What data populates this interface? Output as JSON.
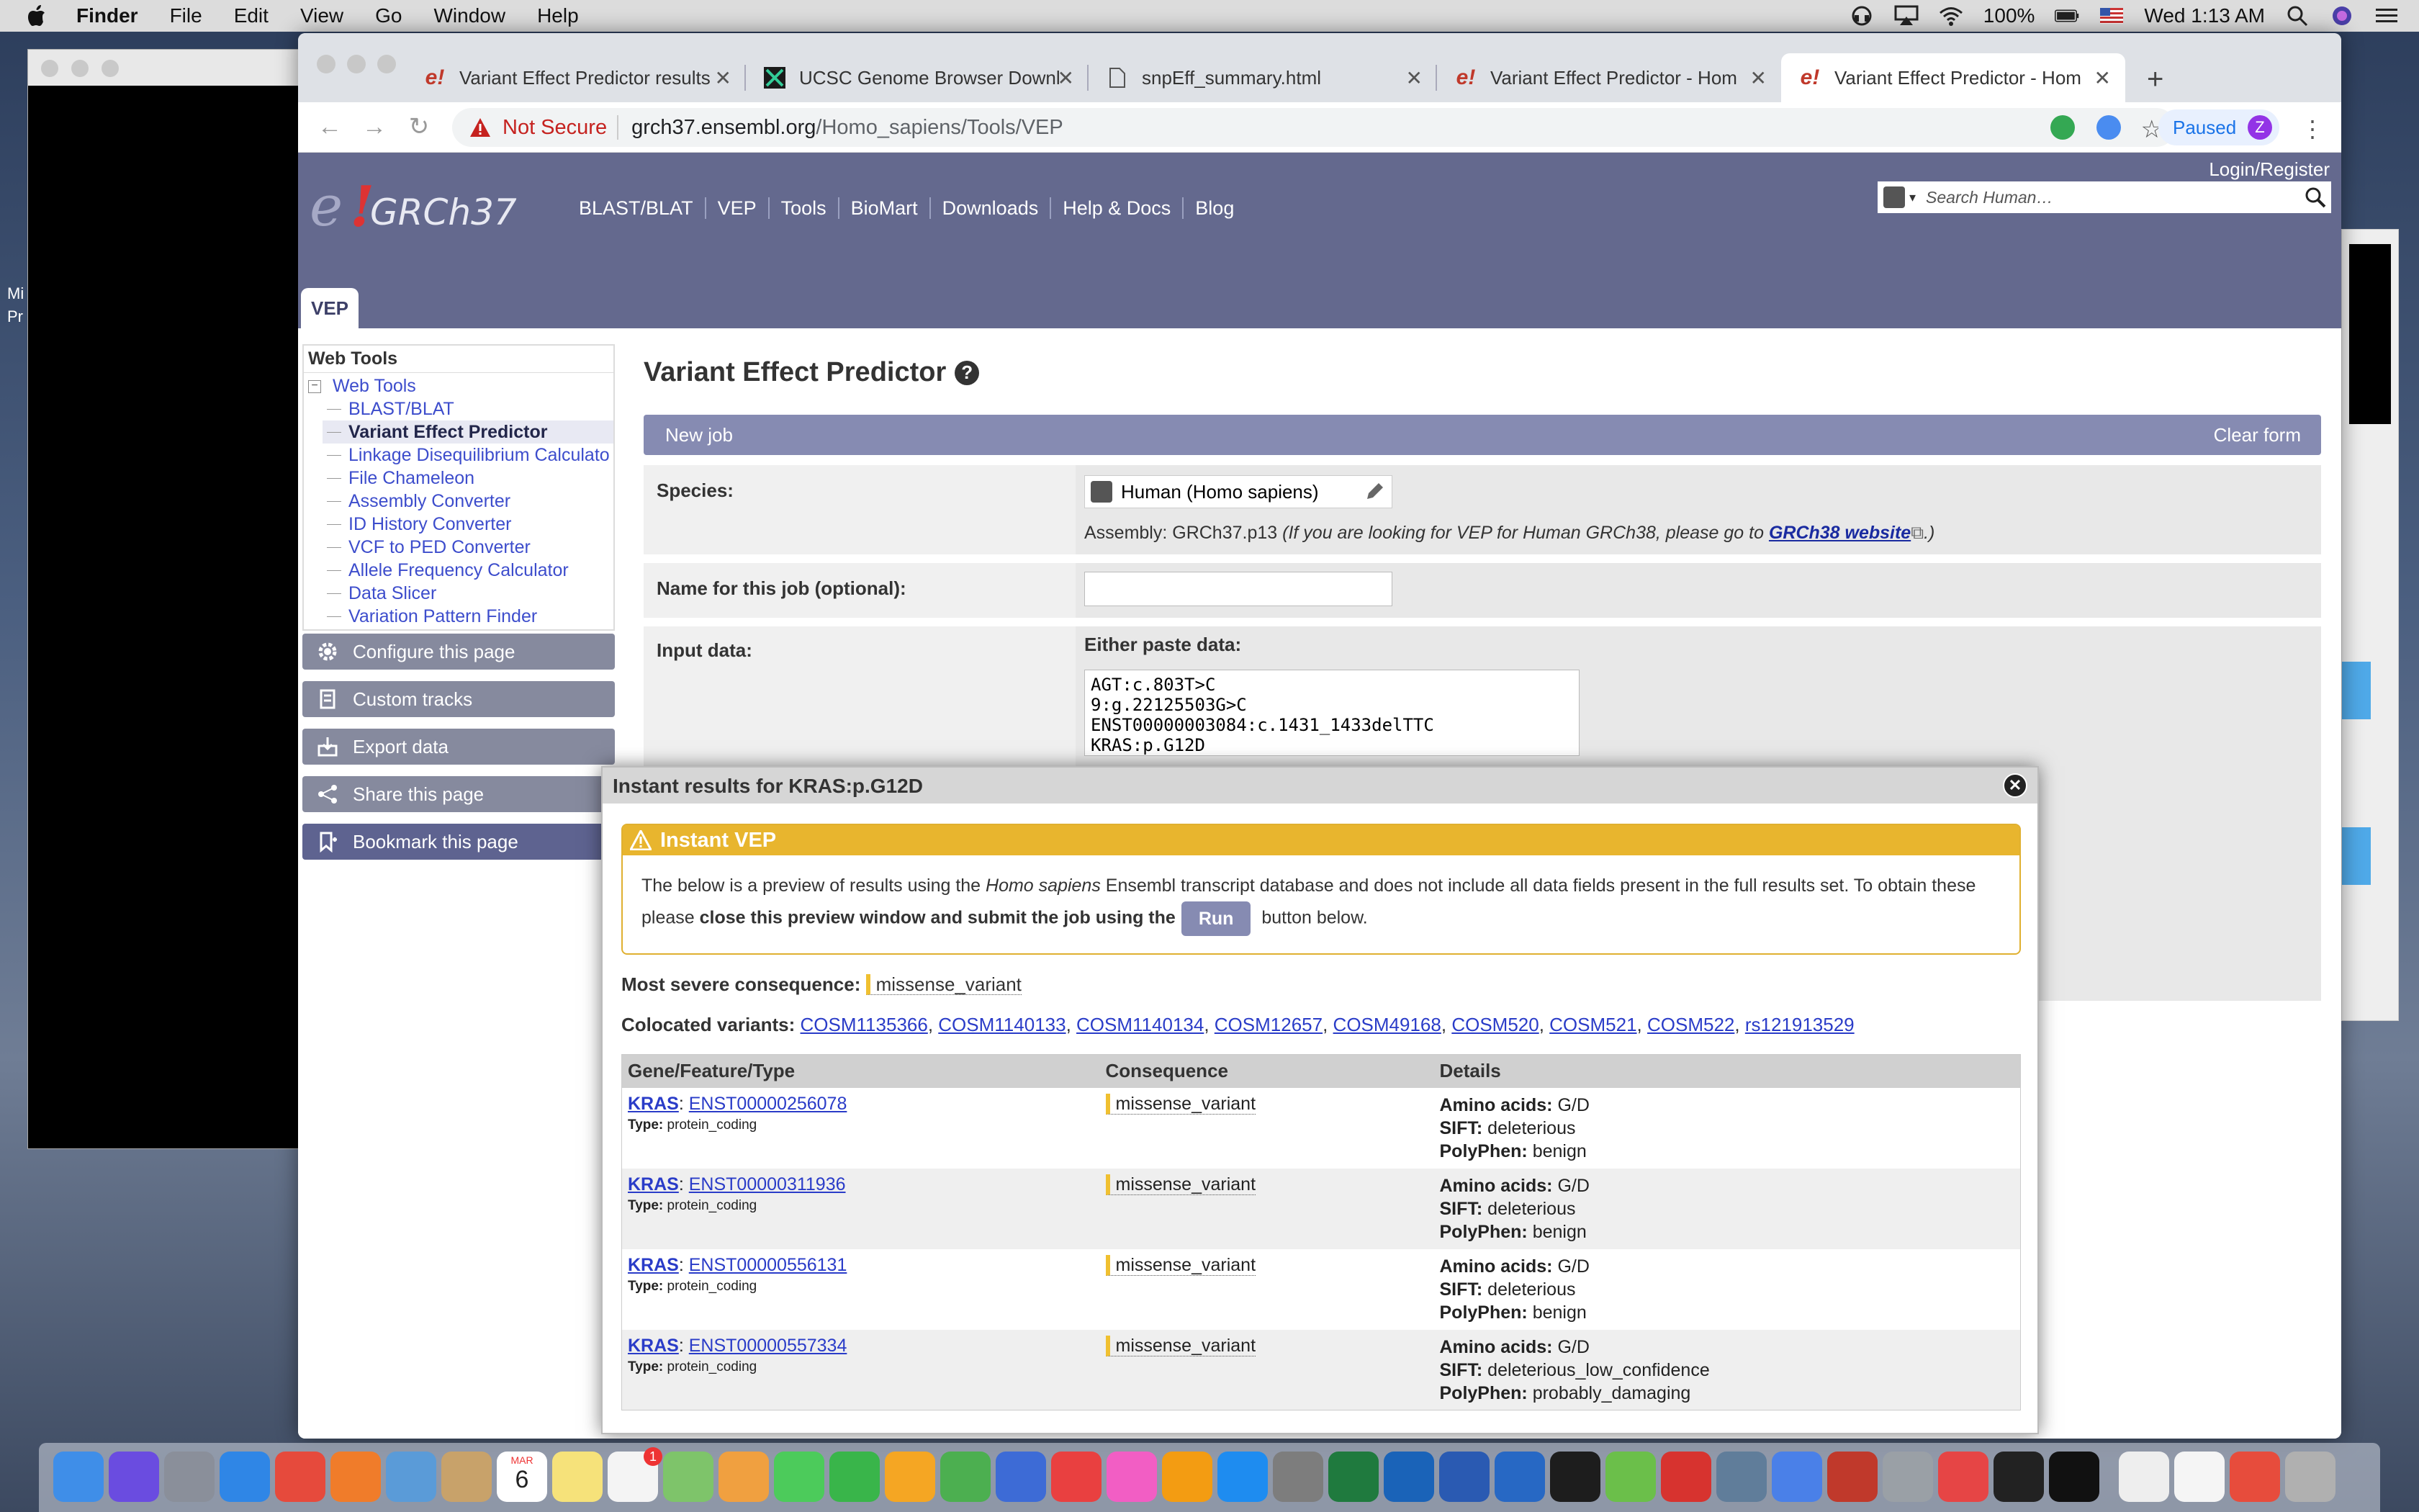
{
  "menubar": {
    "items": [
      "Finder",
      "File",
      "Edit",
      "View",
      "Go",
      "Window",
      "Help"
    ],
    "battery": "100%",
    "clock": "Wed 1:13 AM"
  },
  "desktop": {
    "clipped_text_1": "Mi",
    "clipped_text_2": "Pr"
  },
  "tabs": [
    {
      "title": "Variant Effect Predictor results",
      "favicon": "ensembl-icon"
    },
    {
      "title": "UCSC Genome Browser Downl",
      "favicon": "ucsc-icon"
    },
    {
      "title": "snpEff_summary.html",
      "favicon": "file-icon"
    },
    {
      "title": "Variant Effect Predictor - Hom",
      "favicon": "ensembl-icon"
    },
    {
      "title": "Variant Effect Predictor - Hom",
      "favicon": "ensembl-icon"
    }
  ],
  "omnibox": {
    "security": "Not Secure",
    "host": "grch37.ensembl.org",
    "path": "/Homo_sapiens/Tools/VEP"
  },
  "profile": {
    "label": "Paused",
    "initial": "Z"
  },
  "ensembl": {
    "assembly": "GRCh37",
    "nav": [
      "BLAST/BLAT",
      "VEP",
      "Tools",
      "BioMart",
      "Downloads",
      "Help & Docs",
      "Blog"
    ],
    "login": "Login/Register",
    "search_placeholder": "Search Human…",
    "section_tab": "VEP"
  },
  "sidebar": {
    "header": "Web Tools",
    "root": "Web Tools",
    "items": [
      "BLAST/BLAT",
      "Variant Effect Predictor",
      "Linkage Disequilibrium Calculato",
      "File Chameleon",
      "Assembly Converter",
      "ID History Converter",
      "VCF to PED Converter",
      "Allele Frequency Calculator",
      "Data Slicer",
      "Variation Pattern Finder"
    ],
    "buttons": [
      "Configure this page",
      "Custom tracks",
      "Export data",
      "Share this page",
      "Bookmark this page"
    ]
  },
  "form": {
    "title": "Variant Effect Predictor",
    "new_job": "New job",
    "clear_form": "Clear form",
    "species_label": "Species:",
    "species_value": "Human (Homo sapiens)",
    "assembly_prefix": "Assembly: GRCh37.p13 ",
    "assembly_note": "(If you are looking for VEP for Human GRCh38, please go to ",
    "assembly_link": "GRCh38 website",
    "assembly_suffix": ".)",
    "job_name_label": "Name for this job (optional):",
    "job_name_value": "",
    "input_label": "Input data:",
    "paste_label": "Either paste data:",
    "paste_value": "AGT:c.803T>C\n9:g.22125503G>C\nENST00000003084:c.1431_1433delTTC\nKRAS:p.G12D"
  },
  "popup": {
    "title": "Instant results for KRAS:p.G12D",
    "warning_title": "Instant VEP",
    "warning_text_1": "The below is a preview of results using the ",
    "warning_species": "Homo sapiens",
    "warning_text_2": " Ensembl transcript database and does not include all data fields present in the full results set. To obtain these please ",
    "warning_bold": "close this preview window and submit the job using the",
    "run_label": "Run",
    "warning_text_3": " button below.",
    "most_severe_label": "Most severe consequence:",
    "most_severe_value": "missense_variant",
    "colocated_label": "Colocated variants:",
    "colocated": [
      "COSM1135366",
      "COSM1140133",
      "COSM1140134",
      "COSM12657",
      "COSM49168",
      "COSM520",
      "COSM521",
      "COSM522",
      "rs121913529"
    ],
    "columns": [
      "Gene/Feature/Type",
      "Consequence",
      "Details"
    ],
    "rows": [
      {
        "gene": "KRAS",
        "feature": "ENST00000256078",
        "type": "protein_coding",
        "consequence": "missense_variant",
        "amino": "G/D",
        "sift": "deleterious",
        "polyphen": "benign"
      },
      {
        "gene": "KRAS",
        "feature": "ENST00000311936",
        "type": "protein_coding",
        "consequence": "missense_variant",
        "amino": "G/D",
        "sift": "deleterious",
        "polyphen": "benign"
      },
      {
        "gene": "KRAS",
        "feature": "ENST00000556131",
        "type": "protein_coding",
        "consequence": "missense_variant",
        "amino": "G/D",
        "sift": "deleterious",
        "polyphen": "benign"
      },
      {
        "gene": "KRAS",
        "feature": "ENST00000557334",
        "type": "protein_coding",
        "consequence": "missense_variant",
        "amino": "G/D",
        "sift": "deleterious_low_confidence",
        "polyphen": "probably_damaging"
      }
    ],
    "labels": {
      "type": "Type:",
      "amino": "Amino acids:",
      "sift": "SIFT:",
      "polyphen": "PolyPhen:"
    }
  },
  "dock": {
    "calendar_month": "MAR",
    "calendar_day": "6",
    "reminders_badge": "1",
    "apps": [
      "finder-icon",
      "siri-icon",
      "launchpad-icon",
      "safari-icon",
      "chrome-icon",
      "firefox-icon",
      "preview-icon",
      "notes-icon",
      "calendar-icon",
      "stickies-icon",
      "reminders-icon",
      "photo-icon",
      "photos-icon",
      "messages-icon",
      "facetime-icon",
      "keynote-icon",
      "numbers-icon",
      "keynote2-icon",
      "news-icon",
      "music-icon",
      "books-icon",
      "appstore-icon",
      "settings-icon",
      "excel-icon",
      "outlook-icon",
      "word-icon",
      "r-icon",
      "pycharm-icon",
      "rstudio-icon",
      "youdao-icon",
      "virtualbox-icon",
      "chrome-canary-icon",
      "powerpoint-icon",
      "tex-icon",
      "pdf-icon",
      "terminal-black-icon",
      "terminal-icon",
      "file-icon",
      "doc-icon",
      "pdf-doc-icon",
      "trash-icon"
    ]
  }
}
